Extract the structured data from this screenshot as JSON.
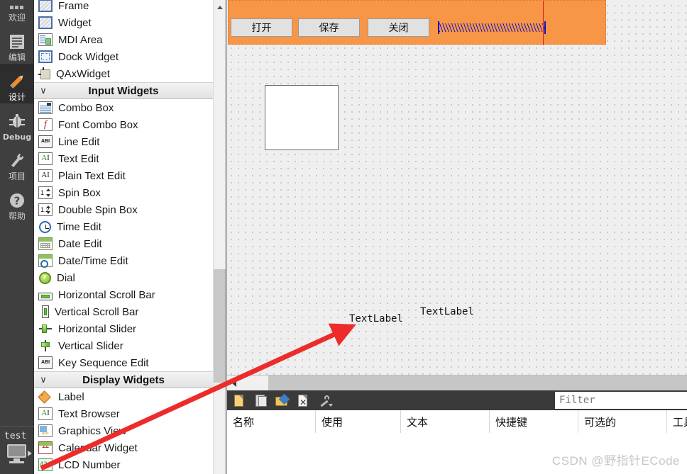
{
  "mode_bar": {
    "items": [
      {
        "label": "欢迎",
        "icon": "welcome-icon",
        "active": false
      },
      {
        "label": "编辑",
        "icon": "edit-icon",
        "active": false
      },
      {
        "label": "设计",
        "icon": "design-pencil-icon",
        "active": true
      },
      {
        "label": "Debug",
        "icon": "debug-bug-icon",
        "active": false
      },
      {
        "label": "项目",
        "icon": "projects-wrench-icon",
        "active": false
      },
      {
        "label": "帮助",
        "icon": "help-question-icon",
        "active": false
      }
    ],
    "kit": {
      "name": "test",
      "icon": "desktop-monitor-icon",
      "arrow": "run-arrow-icon"
    }
  },
  "widget_box": {
    "rows": [
      {
        "type": "item",
        "label": "Frame",
        "icon": "frame-icon"
      },
      {
        "type": "item",
        "label": "Widget",
        "icon": "widget-icon"
      },
      {
        "type": "item",
        "label": "MDI Area",
        "icon": "mdi-area-icon"
      },
      {
        "type": "item",
        "label": "Dock Widget",
        "icon": "dock-widget-icon"
      },
      {
        "type": "item",
        "label": "QAxWidget",
        "icon": "qaxwidget-icon"
      },
      {
        "type": "group",
        "label": "Input Widgets",
        "icon": "chevron-down-icon"
      },
      {
        "type": "item",
        "label": "Combo Box",
        "icon": "combo-box-icon"
      },
      {
        "type": "item",
        "label": "Font Combo Box",
        "icon": "font-combo-box-icon"
      },
      {
        "type": "item",
        "label": "Line Edit",
        "icon": "line-edit-icon"
      },
      {
        "type": "item",
        "label": "Text Edit",
        "icon": "text-edit-icon"
      },
      {
        "type": "item",
        "label": "Plain Text Edit",
        "icon": "plain-text-edit-icon"
      },
      {
        "type": "item",
        "label": "Spin Box",
        "icon": "spin-box-icon"
      },
      {
        "type": "item",
        "label": "Double Spin Box",
        "icon": "double-spin-box-icon"
      },
      {
        "type": "item",
        "label": "Time Edit",
        "icon": "time-edit-icon"
      },
      {
        "type": "item",
        "label": "Date Edit",
        "icon": "date-edit-icon"
      },
      {
        "type": "item",
        "label": "Date/Time Edit",
        "icon": "date-time-edit-icon"
      },
      {
        "type": "item",
        "label": "Dial",
        "icon": "dial-icon"
      },
      {
        "type": "item",
        "label": "Horizontal Scroll Bar",
        "icon": "horizontal-scroll-bar-icon"
      },
      {
        "type": "item",
        "label": "Vertical Scroll Bar",
        "icon": "vertical-scroll-bar-icon"
      },
      {
        "type": "item",
        "label": "Horizontal Slider",
        "icon": "horizontal-slider-icon"
      },
      {
        "type": "item",
        "label": "Vertical Slider",
        "icon": "vertical-slider-icon"
      },
      {
        "type": "item",
        "label": "Key Sequence Edit",
        "icon": "key-sequence-edit-icon"
      },
      {
        "type": "group",
        "label": "Display Widgets",
        "icon": "chevron-down-icon"
      },
      {
        "type": "item",
        "label": "Label",
        "icon": "label-icon"
      },
      {
        "type": "item",
        "label": "Text Browser",
        "icon": "text-browser-icon"
      },
      {
        "type": "item",
        "label": "Graphics View",
        "icon": "graphics-view-icon"
      },
      {
        "type": "item",
        "label": "Calendar Widget",
        "icon": "calendar-widget-icon"
      },
      {
        "type": "item",
        "label": "LCD Number",
        "icon": "lcd-number-icon"
      }
    ]
  },
  "form_editor": {
    "toolbar_color": "#f79646",
    "buttons": [
      {
        "label": "打开",
        "name": "open-button"
      },
      {
        "label": "保存",
        "name": "保存-button"
      },
      {
        "label": "关闭",
        "name": "close-button"
      }
    ],
    "spacer": {
      "name": "horizontal-spacer",
      "color": "#1111c8"
    },
    "labels": [
      {
        "text": "TextLabel"
      },
      {
        "text": "TextLabel"
      }
    ],
    "text_edit": {
      "name": "text-edit-widget"
    }
  },
  "action_editor": {
    "toolbar_icons": [
      {
        "name": "new-action-icon"
      },
      {
        "name": "copy-action-icon"
      },
      {
        "name": "edit-action-icon"
      },
      {
        "name": "delete-action-icon"
      },
      {
        "name": "configure-icon"
      }
    ],
    "filter": {
      "placeholder": "Filter",
      "value": ""
    },
    "columns": [
      {
        "label": "名称"
      },
      {
        "label": "使用"
      },
      {
        "label": "文本"
      },
      {
        "label": "快捷键"
      },
      {
        "label": "可选的"
      },
      {
        "label": "工具"
      }
    ],
    "rows": []
  },
  "annotation": {
    "arrow_color": "#ee2b2b"
  },
  "watermark": {
    "text": "CSDN @野指针ECode"
  }
}
